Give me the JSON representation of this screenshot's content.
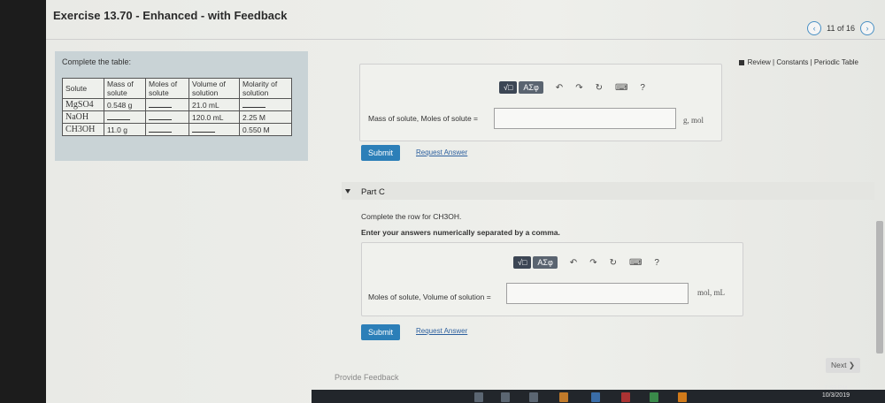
{
  "header": {
    "title": "Exercise 13.70 - Enhanced - with Feedback"
  },
  "pager": {
    "prev_icon": "chevron-left-icon",
    "text": "11 of 16",
    "next_icon": "chevron-right-icon"
  },
  "left_panel": {
    "title": "Complete the table:",
    "columns": [
      "Solute",
      "Mass of solute",
      "Moles of solute",
      "Volume of solution",
      "Molarity of solution"
    ],
    "rows": [
      [
        "MgSO4",
        "0.548 g",
        "",
        "21.0 mL",
        ""
      ],
      [
        "NaOH",
        "",
        "",
        "120.0 mL",
        "2.25 M"
      ],
      [
        "CH3OH",
        "11.0 g",
        "",
        "",
        "0.550 M"
      ]
    ]
  },
  "review_links": "Review | Constants | Periodic Table",
  "toolbar": {
    "templates": "√□",
    "symbols": "ΑΣφ",
    "undo": "↶",
    "redo": "↷",
    "reset": "↻",
    "keyboard": "⌨",
    "help": "?"
  },
  "part_b": {
    "label": "Mass of solute, Moles of solute =",
    "value": "",
    "unit": "g, mol",
    "submit": "Submit",
    "request": "Request Answer"
  },
  "part_c": {
    "title": "Part C",
    "instruction": "Complete the row for CH3OH.",
    "instruction2": "Enter your answers numerically separated by a comma.",
    "label": "Moles of solute, Volume of solution =",
    "value": "",
    "unit": "mol, mL",
    "submit": "Submit",
    "request": "Request Answer"
  },
  "footer": {
    "feedback": "Provide Feedback",
    "next": "Next ❯"
  },
  "taskbar": {
    "time": "7:59 PM",
    "date": "10/3/2019"
  }
}
